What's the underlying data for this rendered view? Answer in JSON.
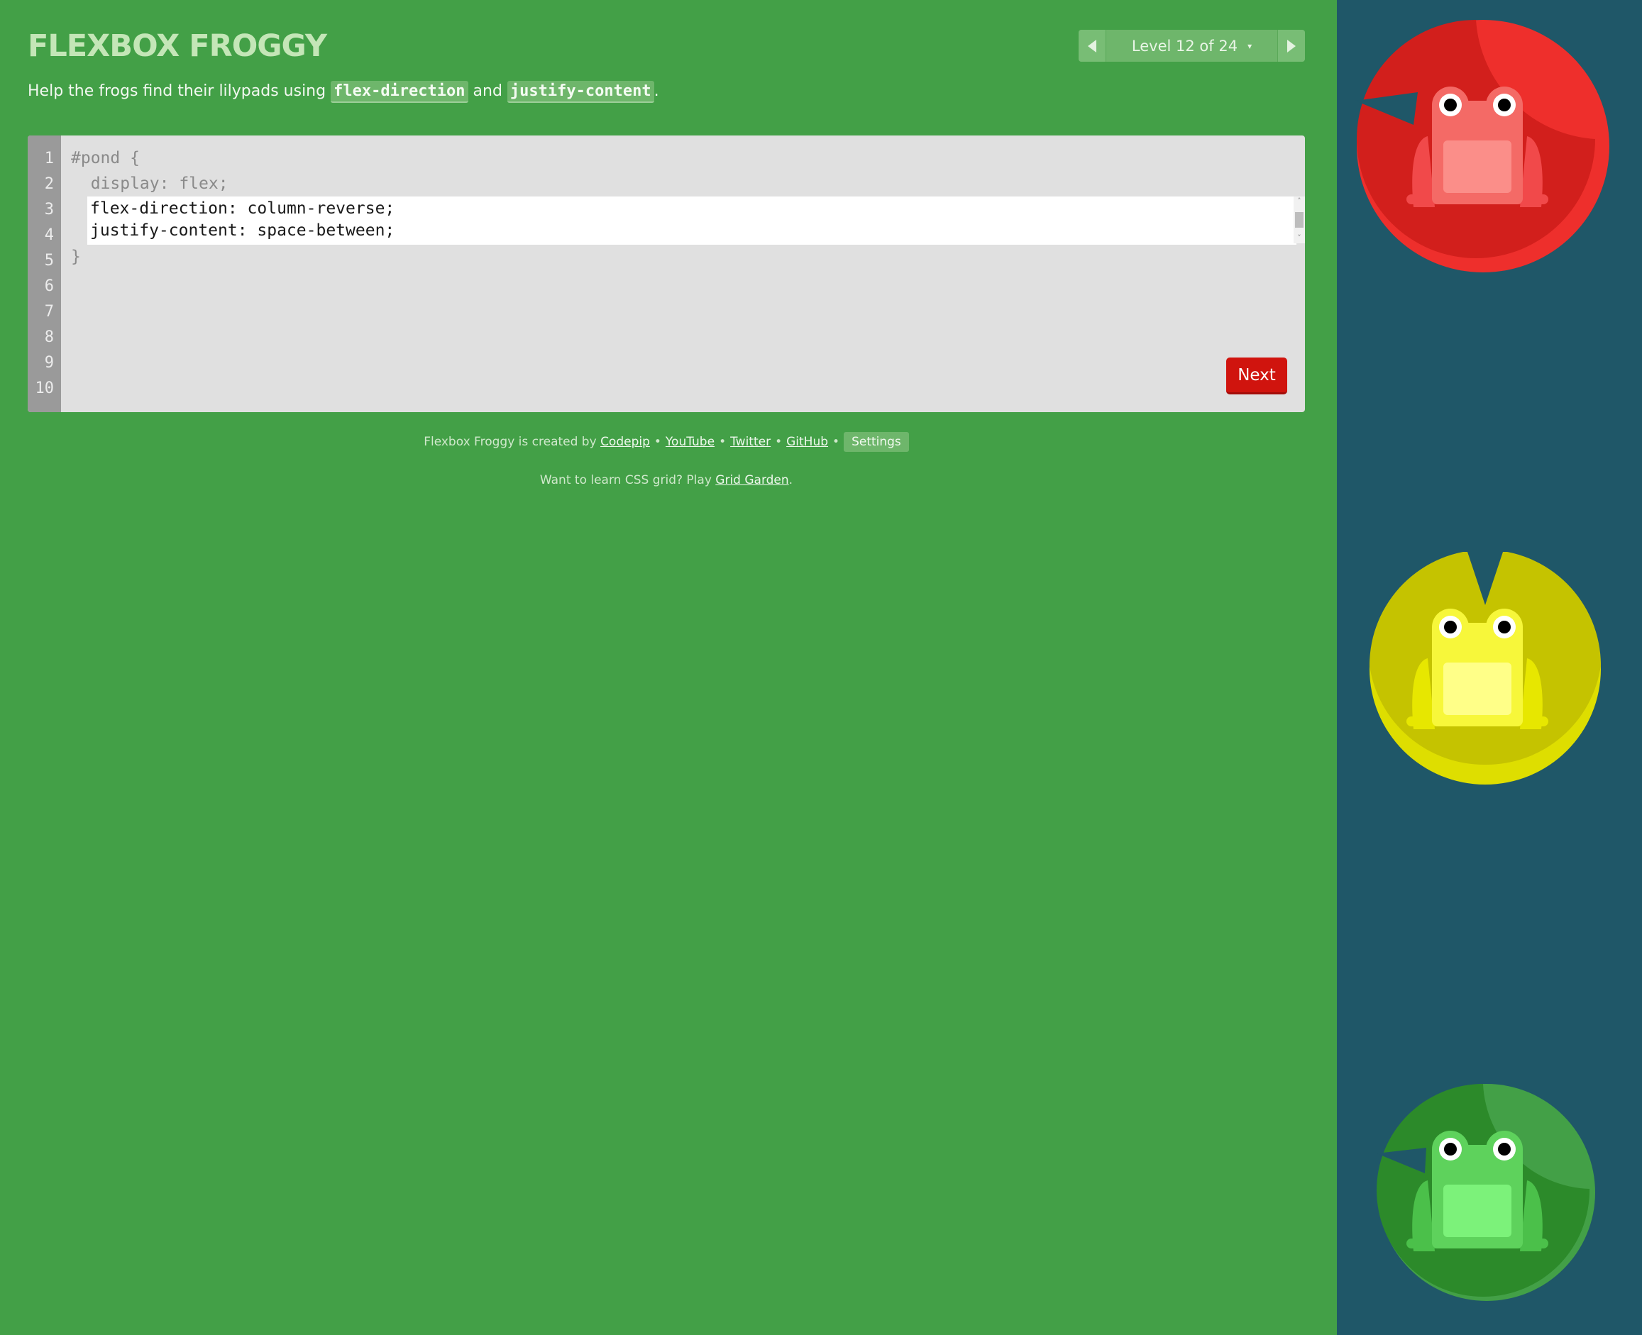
{
  "header": {
    "title": "FLEXBOX FROGGY",
    "level_label": "Level 12 of 24",
    "caret": "▾"
  },
  "instructions": {
    "prefix": "Help the frogs find their lilypads using ",
    "code1": "flex-direction",
    "middle": " and ",
    "code2": "justify-content",
    "suffix": "."
  },
  "editor": {
    "line_numbers": [
      "1",
      "2",
      "3",
      "4",
      "5",
      "6",
      "7",
      "8",
      "9",
      "10"
    ],
    "line1": "#pond {",
    "line2": "  display: flex;",
    "input_value": "flex-direction: column-reverse;\njustify-content: space-between;",
    "line5": "}",
    "next_label": "Next"
  },
  "footer": {
    "created_by": "Flexbox Froggy is created by ",
    "links": [
      "Codepip",
      "YouTube",
      "Twitter",
      "GitHub"
    ],
    "sep": "•",
    "settings_label": "Settings",
    "grid_prefix": "Want to learn CSS grid? Play ",
    "grid_link": "Grid Garden",
    "grid_suffix": "."
  },
  "board": {
    "frogs": [
      {
        "color": "red",
        "pad_color": "#d21f1c"
      },
      {
        "color": "yellow",
        "pad_color": "#c5c300"
      },
      {
        "color": "green",
        "pad_color": "#2c8a2a"
      }
    ]
  },
  "colors": {
    "background": "#43a047",
    "board": "#1f5768",
    "next_button": "#d0140e"
  }
}
